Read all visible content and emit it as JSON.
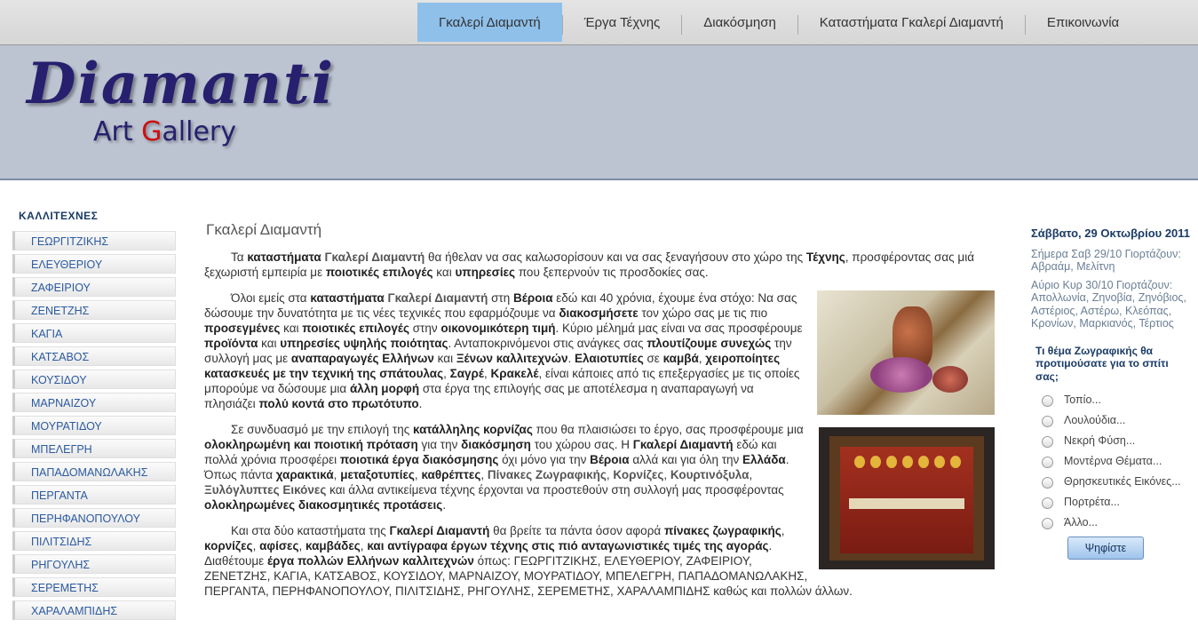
{
  "nav": {
    "items": [
      "Γκαλερί Διαμαντή",
      "Έργα Τέχνης",
      "Διακόσμηση",
      "Καταστήματα Γκαλερί Διαμαντή",
      "Επικοινωνία"
    ]
  },
  "logo": {
    "line1": "Diamanti",
    "line2_a": "Art ",
    "line2_b": "G",
    "line2_c": "allery"
  },
  "sidebar": {
    "title": "ΚΑΛΛΙΤΕΧΝΕΣ",
    "items": [
      "ΓΕΩΡΓΙΤΖΙΚΗΣ",
      "ΕΛΕΥΘΕΡΙΟΥ",
      "ΖΑΦΕΙΡΙΟΥ",
      "ΖΕΝΕΤΖΗΣ",
      "ΚΑΓΙΑ",
      "ΚΑΤΣΑΒΟΣ",
      "ΚΟΥΣΙΔΟΥ",
      "ΜΑΡΝΑΙΖΟΥ",
      "ΜΟΥΡΑΤΙΔΟΥ",
      "ΜΠΕΛΕΓΡΗ",
      "ΠΑΠΑΔΟΜΑΝΩΛΑΚΗΣ",
      "ΠΕΡΓΑΝΤΑ",
      "ΠΕΡΗΦΑΝΟΠΟΥΛΟΥ",
      "ΠΙΛΙΤΣΙΔΗΣ",
      "ΡΗΓΟΥΛΗΣ",
      "ΣΕΡΕΜΕΤΗΣ",
      "ΧΑΡΑΛΑΜΠΙΔΗΣ"
    ]
  },
  "main": {
    "title": "Γκαλερί Διαμαντή",
    "p1": [
      [
        "t",
        "Τα "
      ],
      [
        "b",
        "καταστήματα"
      ],
      [
        "t",
        " "
      ],
      [
        "g",
        "Γκαλερί Διαμαντή"
      ],
      [
        "t",
        " θα ήθελαν να σας καλωσορίσουν και να σας ξεναγήσουν στο χώρο της "
      ],
      [
        "b",
        "Τέχνης"
      ],
      [
        "t",
        ", προσφέροντας σας μιά ξεχωριστή εμπειρία με "
      ],
      [
        "b",
        "ποιοτικές επιλογές"
      ],
      [
        "t",
        " και "
      ],
      [
        "b",
        "υπηρεσίες"
      ],
      [
        "t",
        " που ξεπερνούν τις προσδοκίες σας."
      ]
    ],
    "p2": [
      [
        "t",
        "Όλοι εμείς στα "
      ],
      [
        "b",
        "καταστήματα"
      ],
      [
        "t",
        " "
      ],
      [
        "g",
        "Γκαλερί Διαμαντή"
      ],
      [
        "t",
        " στη "
      ],
      [
        "b",
        "Βέροια"
      ],
      [
        "t",
        " εδώ και 40 χρόνια, έχουμε ένα στόχο: Να σας δώσουμε την δυνατότητα με τις νέες τεχνικές που εφαρμόζουμε να "
      ],
      [
        "b",
        "διακοσμήσετε"
      ],
      [
        "t",
        " τον χώρο σας με τις πιο "
      ],
      [
        "b",
        "προσεγμένες"
      ],
      [
        "t",
        " και "
      ],
      [
        "b",
        "ποιοτικές επιλογές"
      ],
      [
        "t",
        " στην "
      ],
      [
        "b",
        "οικονομικότερη τιμή"
      ],
      [
        "t",
        ". Κύριο μέλημά μας είναι να σας προσφέρουμε "
      ],
      [
        "b",
        "προϊόντα"
      ],
      [
        "t",
        " και "
      ],
      [
        "b",
        "υπηρεσίες υψηλής ποιότητας"
      ],
      [
        "t",
        ". Ανταποκρινόμενοι στις ανάγκες σας "
      ],
      [
        "b",
        "πλουτίζουμε συνεχώς"
      ],
      [
        "t",
        " την συλλογή μας με "
      ],
      [
        "b",
        "αναπαραγωγές Ελλήνων"
      ],
      [
        "t",
        " και "
      ],
      [
        "b",
        "Ξένων καλλιτεχνών"
      ],
      [
        "t",
        ". "
      ],
      [
        "b",
        "Ελαιοτυπίες"
      ],
      [
        "t",
        " σε "
      ],
      [
        "b",
        "καμβά"
      ],
      [
        "t",
        ", "
      ],
      [
        "b",
        "χειροποίητες κατασκευές με την τεχνική της σπάτουλας"
      ],
      [
        "t",
        ", "
      ],
      [
        "b",
        "Σαγρέ"
      ],
      [
        "t",
        ", "
      ],
      [
        "b",
        "Κρακελέ"
      ],
      [
        "t",
        ", είναι κάποιες από τις επεξεργασίες με τις οποίες μπορούμε να δώσουμε μια "
      ],
      [
        "b",
        "άλλη μορφή"
      ],
      [
        "t",
        " στα έργα της επιλογής σας με αποτέλεσμα η αναπαραγωγή να πλησιάζει "
      ],
      [
        "b",
        "πολύ κοντά στο πρωτότυπο"
      ],
      [
        "t",
        "."
      ]
    ],
    "p3": [
      [
        "t",
        "Σε συνδυασμό με την επιλογή της "
      ],
      [
        "b",
        "κατάλληλης κορνίζας"
      ],
      [
        "t",
        " που θα πλαισιώσει το έργο, σας προσφέρουμε μια "
      ],
      [
        "b",
        "ολοκληρωμένη και ποιοτική πρόταση"
      ],
      [
        "t",
        " για την "
      ],
      [
        "b",
        "διακόσμηση"
      ],
      [
        "t",
        " του χώρου σας. Η "
      ],
      [
        "b",
        "Γκαλερί Διαμαντή"
      ],
      [
        "t",
        " εδώ και πολλά χρόνια προσφέρει "
      ],
      [
        "b",
        "ποιοτικά έργα διακόσμησης"
      ],
      [
        "t",
        " όχι μόνο για την "
      ],
      [
        "b",
        "Βέροια"
      ],
      [
        "t",
        " αλλά και για όλη την "
      ],
      [
        "b",
        "Ελλάδα"
      ],
      [
        "t",
        ". Όπως πάντα "
      ],
      [
        "b",
        "χαρακτικά"
      ],
      [
        "t",
        ", "
      ],
      [
        "b",
        "μεταξοτυπίες"
      ],
      [
        "t",
        ", "
      ],
      [
        "b",
        "καθρέπτες"
      ],
      [
        "t",
        ", "
      ],
      [
        "g",
        "Πίνακες Ζωγραφικής"
      ],
      [
        "t",
        ", "
      ],
      [
        "g",
        "Κορνίζες"
      ],
      [
        "t",
        ", "
      ],
      [
        "g",
        "Κουρτινόξυλα"
      ],
      [
        "t",
        ", "
      ],
      [
        "g",
        "Ξυλόγλυπτες Εικόνες"
      ],
      [
        "t",
        " και άλλα αντικείμενα τέχνης έρχονται να προστεθούν στη συλλογή μας προσφέροντας "
      ],
      [
        "b",
        "ολοκληρωμένες διακοσμητικές προτάσεις"
      ],
      [
        "t",
        "."
      ]
    ],
    "p4": [
      [
        "t",
        "Και στα δύο καταστήματα της "
      ],
      [
        "b",
        "Γκαλερί Διαμαντή"
      ],
      [
        "t",
        " θα βρείτε τα πάντα όσον αφορά "
      ],
      [
        "b",
        "πίνακες ζωγραφικής"
      ],
      [
        "t",
        ", "
      ],
      [
        "b",
        "κορνίζες"
      ],
      [
        "t",
        ", "
      ],
      [
        "b",
        "αφίσες"
      ],
      [
        "t",
        ", "
      ],
      [
        "b",
        "καμβάδες"
      ],
      [
        "t",
        ", "
      ],
      [
        "b",
        "και αντίγραφα έργων τέχνης στις πιό ανταγωνιστικές τιμές της αγοράς"
      ],
      [
        "t",
        ". Διαθέτουμε "
      ],
      [
        "b",
        "έργα πολλών Ελλήνων  καλλιτεχνών"
      ],
      [
        "t",
        " όπως:  ΓΕΩΡΓΙΤΖΙΚΗΣ, ΕΛΕΥΘΕΡΙΟΥ, ΖΑΦΕΙΡΙΟΥ, ΖΕΝΕΤΖΗΣ, ΚΑΓΙΑ, ΚΑΤΣΑΒΟΣ, ΚΟΥΣΙΔΟΥ, ΜΑΡΝΑΙΖΟΥ, ΜΟΥΡΑΤΙΔΟΥ, ΜΠΕΛΕΓΡΗ, ΠΑΠΑΔΟΜΑΝΩΛΑΚΗΣ, ΠΕΡΓΑΝΤΑ, ΠΕΡΗΦΑΝΟΠΟΥΛΟΥ, ΠΙΛΙΤΣΙΔΗΣ, ΡΗΓΟΥΛΗΣ, ΣΕΡΕΜΕΤΗΣ, ΧΑΡΑΛΑΜΠΙΔΗΣ καθώς και πολλών άλλων."
      ]
    ]
  },
  "right": {
    "date": "Σάββατο, 29 Οκτωβρίου 2011",
    "today": "Σήμερα Σαβ 29/10 Γιορτάζουν: Αβραάμ, Μελίτνη",
    "tomorrow": "Αύριο Κυρ 30/10 Γιορτάζουν: Απολλωνία, Ζηνοβία, Ζηνόβιος, Αστέριος, Αστέρω, Κλεόπας, Κρονίων, Μαρκιανός, Τέρτιος",
    "poll_question": "Τι θέμα Ζωγραφικής θα προτιμούσατε για το σπίτι σας;",
    "poll_options": [
      "Τοπίο...",
      "Λουλούδια...",
      "Νεκρή Φύση...",
      "Μοντέρνα Θέματα...",
      "Θρησκευτικές Εικόνες...",
      "Πορτρέτα...",
      "Άλλο..."
    ],
    "vote_label": "Ψηφίστε"
  }
}
